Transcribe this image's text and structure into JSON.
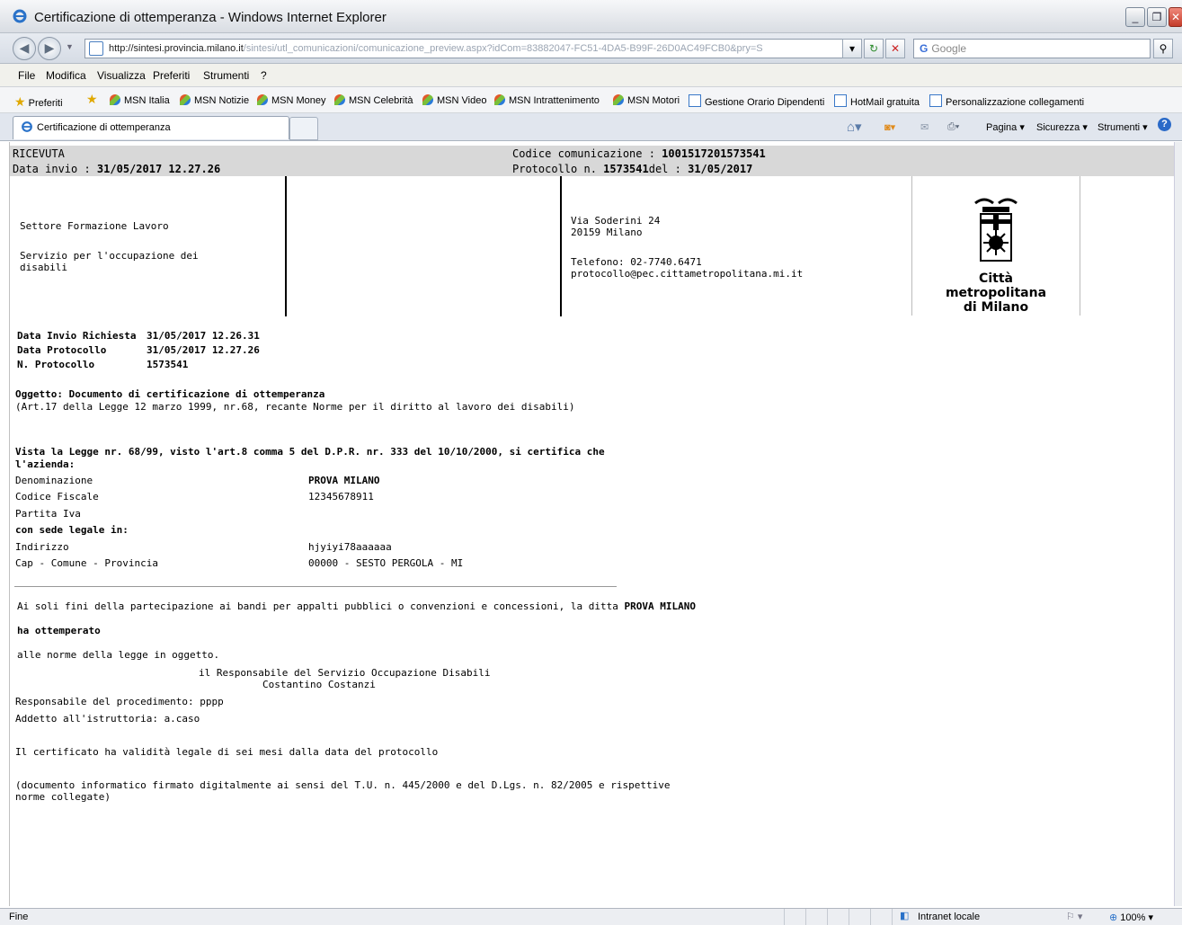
{
  "window": {
    "title": "Certificazione di ottemperanza - Windows Internet Explorer"
  },
  "address": {
    "host": "http://sintesi.provincia.milano.it",
    "path": "/sintesi/utl_comunicazioni/comunicazione_preview.aspx?idCom=83882047-FC51-4DA5-B99F-26D0AC49FCB0&pry=S"
  },
  "search": {
    "placeholder": "Google"
  },
  "menu": [
    "File",
    "Modifica",
    "Visualizza",
    "Preferiti",
    "Strumenti",
    "?"
  ],
  "favorites": {
    "label": "Preferiti",
    "items": [
      "MSN Italia",
      "MSN Notizie",
      "MSN Money",
      "MSN Celebrità",
      "MSN Video",
      "MSN Intrattenimento",
      "MSN Motori",
      "Gestione Orario Dipendenti",
      "HotMail gratuita",
      "Personalizzazione collegamenti"
    ]
  },
  "tab": {
    "title": "Certificazione di ottemperanza"
  },
  "commands": {
    "page": "Pagina",
    "security": "Sicurezza",
    "tools": "Strumenti"
  },
  "receipt": {
    "title": "RICEVUTA",
    "send_date_label": "Data invio : ",
    "send_date": "31/05/2017 12.27.26",
    "code_label": "Codice comunicazione : ",
    "code": "1001517201573541",
    "protocol_label": "Protocollo n. ",
    "protocol": "1573541",
    "protocol_del": "del : ",
    "protocol_date": "31/05/2017"
  },
  "header": {
    "sector": "Settore Formazione Lavoro",
    "service": "Servizio per l'occupazione dei disabili",
    "address1": "Via Soderini 24",
    "address2": "20159 Milano",
    "phone": "Telefono: 02-7740.6471",
    "email": "protocollo@pec.cittametropolitana.mi.it",
    "logo_line1": "Città",
    "logo_line2": "metropolitana",
    "logo_line3": "di Milano"
  },
  "meta": {
    "request_label": "Data Invio Richiesta",
    "request_value": "31/05/2017 12.26.31",
    "protocol_date_label": "Data Protocollo",
    "protocol_date_value": "31/05/2017 12.27.26",
    "protocol_no_label": "N. Protocollo",
    "protocol_no_value": "1573541"
  },
  "subject": {
    "title": "Oggetto: Documento di certificazione di ottemperanza",
    "subtitle": "(Art.17 della Legge 12 marzo 1999, nr.68, recante Norme per il diritto al lavoro dei disabili)"
  },
  "law": {
    "line1": "Vista la Legge nr. 68/99, visto l'art.8 comma 5 del D.P.R. nr. 333 del 10/10/2000, si certifica che",
    "line2": "l'azienda:"
  },
  "company": {
    "name_label": "Denominazione",
    "name_value": "PROVA MILANO",
    "fiscal_label": "Codice Fiscale",
    "fiscal_value": "12345678911",
    "vat_label": "Partita Iva",
    "vat_value": "",
    "seat_label": "con sede legale in:",
    "address_label": "Indirizzo",
    "address_value": "hjyiyi78aaaaaa",
    "city_label": "Cap - Comune - Provincia",
    "city_value": "00000 - SESTO PERGOLA - MI"
  },
  "body": {
    "line1": "Ai soli fini della partecipazione ai bandi per appalti pubblici o convenzioni e concessioni, la ditta ",
    "line1_company": "PROVA MILANO",
    "complied": "ha ottemperato",
    "norms": "alle norme della legge in oggetto.",
    "responsible_title": "il Responsabile del Servizio Occupazione Disabili",
    "responsible_name": "Costantino Costanzi",
    "procedure": "Responsabile del procedimento: pppp",
    "assigned": "Addetto all'istruttoria: a.caso",
    "validity": "Il certificato ha validità legale di sei mesi dalla data del protocollo",
    "signed1": "(documento informatico firmato digitalmente ai sensi del T.U. n. 445/2000 e del D.Lgs. n. 82/2005 e rispettive",
    "signed2": "norme collegate)"
  },
  "status": {
    "left": "Fine",
    "zone": "Intranet locale",
    "zoom": "100%"
  }
}
